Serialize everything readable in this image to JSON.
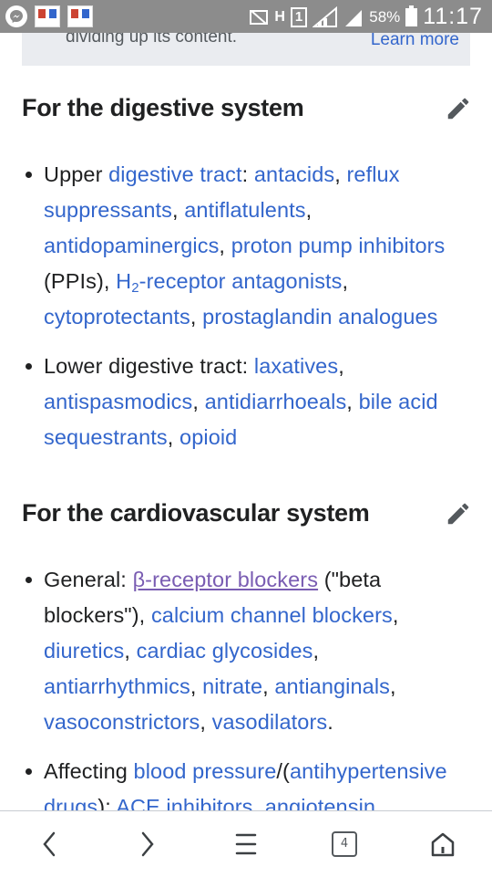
{
  "status_bar": {
    "carrier_indicator": "H",
    "sim_slot": "1",
    "battery_percent": "58%",
    "time": "11:17",
    "icons": [
      "messenger-icon",
      "app-thumbnail-icon",
      "app-thumbnail-icon",
      "mute-icon",
      "signal-icon",
      "signal-icon",
      "battery-icon"
    ]
  },
  "notice": {
    "text": "dividing up its content.",
    "link": "Learn more"
  },
  "sections": [
    {
      "heading": "For the digestive system",
      "edit_icon": "pencil-icon"
    },
    {
      "heading": "For the cardiovascular system",
      "edit_icon": "pencil-icon"
    }
  ],
  "text": {
    "upper_prefix": "Upper ",
    "lower_label": "Lower digestive tract: ",
    "general_label": "General: ",
    "affecting_label": "Affecting ",
    "colon": ": ",
    "comma": ", ",
    "ppis": " (PPIs), ",
    "h2_main": "H",
    "h2_sub": "2",
    "beta_note": " (\"beta blockers\"), ",
    "period": ".",
    "slash_paren": "/(",
    "close_paren_colon": "): "
  },
  "links": {
    "digestive_tract": "digestive tract",
    "antacids": "antacids",
    "reflux_suppressants": "reflux suppressants",
    "antiflatulents": "antiflatulents",
    "antidopaminergics": "antidopaminergics",
    "proton_pump_inhibitors": "proton pump inhibitors",
    "h2_antagonists": "-receptor antagonists",
    "cytoprotectants": "cytoprotectants",
    "prostaglandin_analogues": "prostaglandin analogues",
    "laxatives": "laxatives",
    "antispasmodics": "antispasmodics",
    "antidiarrhoeals": "antidiarrhoeals",
    "bile_acid_sequestrants": "bile acid sequestrants",
    "opioid": "opioid",
    "beta_receptor_blockers": "β-receptor blockers",
    "calcium_channel_blockers": "calcium channel blockers",
    "diuretics": "diuretics",
    "cardiac_glycosides": "cardiac glycosides",
    "antiarrhythmics": "antiarrhythmics",
    "nitrate": "nitrate",
    "antianginals": "antianginals",
    "vasoconstrictors": "vasoconstrictors",
    "vasodilators": "vasodilators",
    "blood_pressure": "blood pressure",
    "antihypertensive_drugs": "antihypertensive drugs",
    "ace_inhibitors": "ACE inhibitors",
    "angiotensin": "angiotensin"
  },
  "bottom_nav": {
    "tab_count": "4",
    "icons": [
      "back-icon",
      "forward-icon",
      "menu-icon",
      "tabs-icon",
      "home-icon"
    ]
  },
  "colors": {
    "link": "#3366cc",
    "visited_link": "#795cb2",
    "text": "#202122",
    "status_bar": "#8c8c8c"
  }
}
